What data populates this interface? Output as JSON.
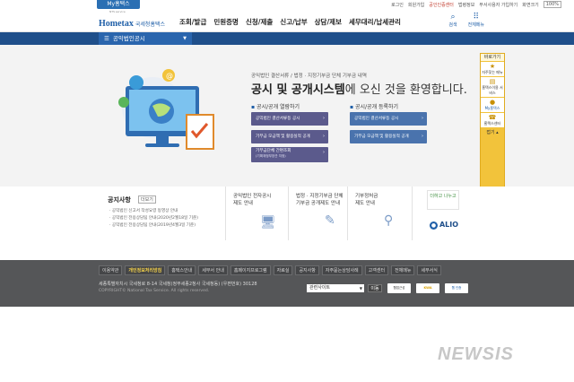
{
  "top": {
    "my_tab": "My홈택스",
    "links": [
      "로그인",
      "회원가입",
      "공인인증센터",
      "법령정보",
      "부서사용자 가입하기",
      "화면크기"
    ],
    "zoom": "100%"
  },
  "header": {
    "logo_main": "Hometax",
    "logo_sub": "국세청홈택스",
    "logo_tiny": "NTS service",
    "gnb": [
      "조회/발급",
      "민원증명",
      "신청/제출",
      "신고/납부",
      "상담/제보",
      "세무대리/납세관리"
    ],
    "search_label": "검색",
    "allmenu_label": "전체메뉴"
  },
  "subnav": {
    "label": "공익법인공시"
  },
  "welcome": {
    "sub": "공익법인 결산서류 / 법정 · 지정기부금 단체 기부금 내역",
    "main_bold": "공시 및 공개시스템",
    "main_rest": "에 오신 것을 환영합니다."
  },
  "left_section": {
    "title": "공시/공개 열람하기",
    "buttons": [
      {
        "label": "공익법인 결산서류등 공시"
      },
      {
        "label": "기부금 모금액 및 활용실적 공개"
      },
      {
        "label": "기부금단체 간편조회",
        "sub": "(기획재정부장관 지정)"
      }
    ]
  },
  "right_section": {
    "title": "공시/공개 등록하기",
    "buttons": [
      {
        "label": "공익법인 결산서류등 공시"
      },
      {
        "label": "기부금 모금액 및 활용실적 공개"
      }
    ]
  },
  "sidebar": {
    "header": "바로가기",
    "items": [
      "자주찾는 메뉴",
      "홈택스이용 서비스",
      "My홈택스",
      "홈택스센터"
    ],
    "footer": "접기"
  },
  "notice": {
    "title": "공지사항",
    "more": "더보기",
    "items": [
      "공익법인 신고서 작성요령 동영상 안내",
      "공익법인 전용상담팀 안내(2020년2월18일 기준)",
      "공익법인 전용상담팀 안내(2019년4월3일 기준)"
    ]
  },
  "cards": [
    {
      "line1": "공익법인 전자공시",
      "line2": "제도 안내"
    },
    {
      "line1": "법정 · 지정기부금 단체",
      "line2": "기부금 공개제도 안내"
    },
    {
      "line1": "기부정처금",
      "line2": "제도 안내"
    }
  ],
  "alio": {
    "top": "더하고 나누고",
    "bottom": "ALIO"
  },
  "footer": {
    "links": [
      "이용약관",
      "개인정보처리방침",
      "홈택스안내",
      "세무서 안내",
      "홈페이지프로그램",
      "자료실",
      "공지사항",
      "자주묻는상담사례",
      "고객센터",
      "전체메뉴",
      "세무서식"
    ],
    "highlight_index": 1,
    "address": "세종특별자치시 국세청로 8-14 국세청(정부세종2청사 국세청동) (우편번호) 30128",
    "copyright": "COPYRIGHT© National Tax Service. All rights reserved.",
    "related_site": "관련사이트",
    "go": "이동",
    "badges": [
      "웹접근성",
      "KWA",
      "웹 인증"
    ]
  },
  "watermark": "NEWSIS"
}
